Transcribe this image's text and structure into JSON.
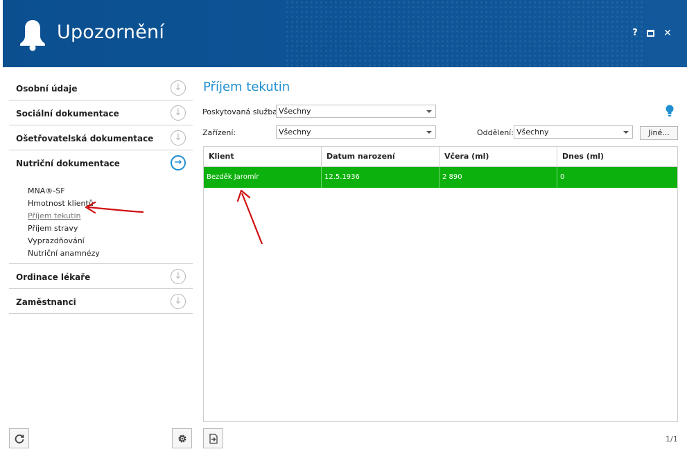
{
  "window": {
    "title": "Upozornění",
    "help_label": "?",
    "close_label": "✕"
  },
  "sidebar": {
    "sections": [
      {
        "label": "Osobní údaje",
        "icon": "arrow-down-circle-icon"
      },
      {
        "label": "Sociální dokumentace",
        "icon": "arrow-down-circle-icon"
      },
      {
        "label": "Ošetřovatelská dokumentace",
        "icon": "arrow-down-circle-icon"
      },
      {
        "label": "Nutriční dokumentace",
        "icon": "arrow-right-circle-icon",
        "active": true
      },
      {
        "label": "Ordinace lékaře",
        "icon": "arrow-down-circle-icon"
      },
      {
        "label": "Zaměstnanci",
        "icon": "arrow-down-circle-icon"
      }
    ],
    "subitems": [
      {
        "label": "MNA®-SF"
      },
      {
        "label": "Hmotnost klientů"
      },
      {
        "label": "Příjem tekutin",
        "current": true
      },
      {
        "label": "Příjem stravy"
      },
      {
        "label": "Vyprazdňování"
      },
      {
        "label": "Nutriční anamnézy"
      }
    ]
  },
  "main": {
    "title": "Příjem tekutin",
    "filters": {
      "service_label": "Poskytovaná služba:",
      "service_value": "Všechny",
      "facility_label": "Zařízení:",
      "facility_value": "Všechny",
      "department_label": "Oddělení:",
      "department_value": "Všechny",
      "other_button": "Jiné..."
    },
    "table": {
      "columns": [
        "Klient",
        "Datum narození",
        "Včera (ml)",
        "Dnes (ml)"
      ],
      "rows": [
        [
          "Bezděk Jaromír",
          "12.5.1936",
          "2 890",
          "0"
        ]
      ],
      "selected_row_color": "#0db10d"
    },
    "pager": "1/1"
  },
  "colors": {
    "header": "#0d5597",
    "accent": "#1f8fd0",
    "annotation_arrow": "#d01010"
  }
}
